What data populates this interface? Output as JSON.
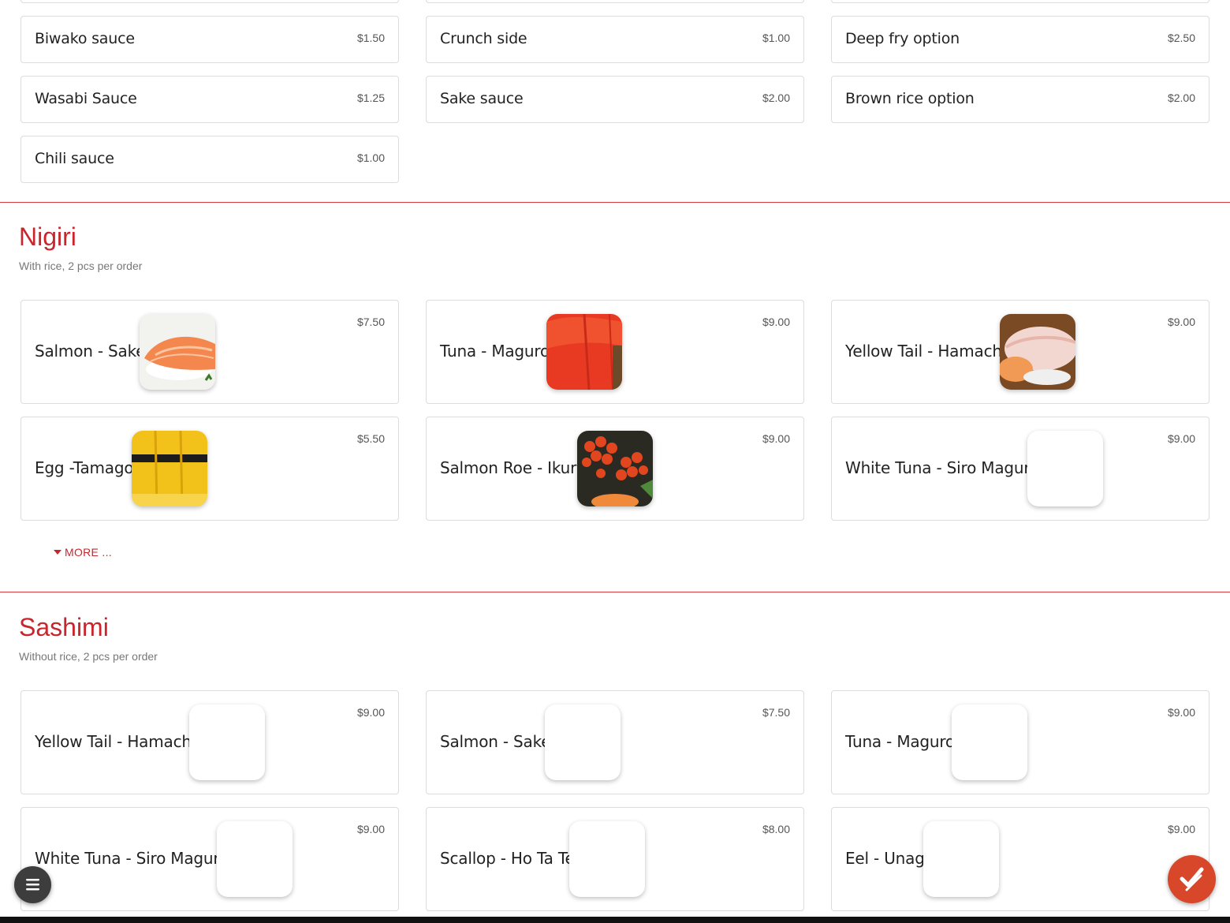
{
  "sauces": [
    {
      "name": "Biwako sauce",
      "price": "$1.50"
    },
    {
      "name": "Crunch side",
      "price": "$1.00"
    },
    {
      "name": "Deep fry option",
      "price": "$2.50"
    },
    {
      "name": "Wasabi Sauce",
      "price": "$1.25"
    },
    {
      "name": "Sake sauce",
      "price": "$2.00"
    },
    {
      "name": "Brown rice option",
      "price": "$2.00"
    },
    {
      "name": "Chili sauce",
      "price": "$1.00"
    }
  ],
  "nigiri": {
    "title": "Nigiri",
    "subtitle": "With rice, 2 pcs per order",
    "more_label": "MORE ...",
    "items": [
      {
        "name": "Salmon - Sake",
        "price": "$7.50"
      },
      {
        "name": "Tuna - Maguro",
        "price": "$9.00"
      },
      {
        "name": "Yellow Tail - Hamachi",
        "price": "$9.00"
      },
      {
        "name": "Egg -Tamago",
        "price": "$5.50"
      },
      {
        "name": "Salmon Roe - Ikura",
        "price": "$9.00"
      },
      {
        "name": "White Tuna - Siro Maguro",
        "price": "$9.00"
      }
    ]
  },
  "sashimi": {
    "title": "Sashimi",
    "subtitle": "Without rice, 2 pcs per order",
    "items": [
      {
        "name": "Yellow Tail - Hamachi",
        "price": "$9.00"
      },
      {
        "name": "Salmon - Sake",
        "price": "$7.50"
      },
      {
        "name": "Tuna - Maguro",
        "price": "$9.00"
      },
      {
        "name": "White Tuna - Siro Maguro",
        "price": "$9.00"
      },
      {
        "name": "Scallop - Ho Ta Te",
        "price": "$8.00"
      },
      {
        "name": "Eel - Unagi",
        "price": "$9.00"
      }
    ]
  },
  "colors": {
    "accent": "#c9252c",
    "fab_order": "#d9472b",
    "fab_menu": "#3d3d3d"
  },
  "icons": {
    "menu": "hamburger-icon",
    "order": "checkmark-icon",
    "more": "caret-down-icon"
  }
}
